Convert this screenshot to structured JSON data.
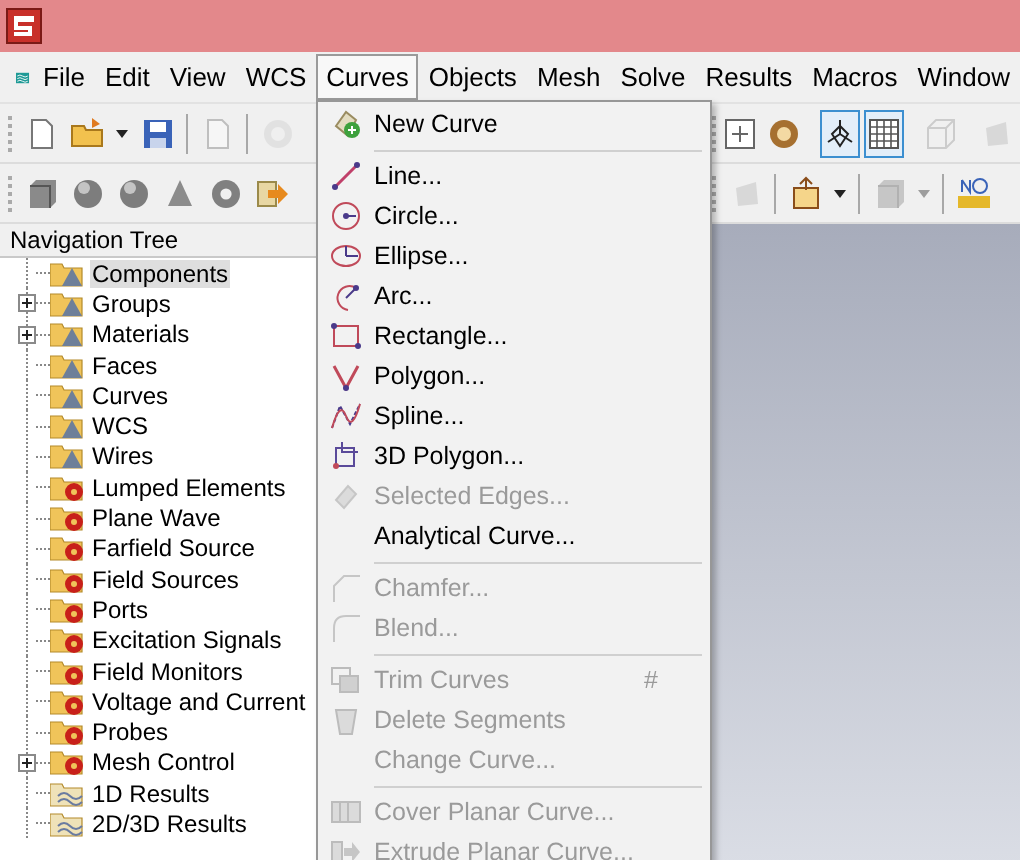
{
  "menu_bar": [
    {
      "label": "File",
      "selected": false
    },
    {
      "label": "Edit",
      "selected": false
    },
    {
      "label": "View",
      "selected": false
    },
    {
      "label": "WCS",
      "selected": false
    },
    {
      "label": "Curves",
      "selected": true
    },
    {
      "label": "Objects",
      "selected": false
    },
    {
      "label": "Mesh",
      "selected": false
    },
    {
      "label": "Solve",
      "selected": false
    },
    {
      "label": "Results",
      "selected": false
    },
    {
      "label": "Macros",
      "selected": false
    },
    {
      "label": "Window",
      "selected": false
    }
  ],
  "toolbar_1": {
    "left": [
      {
        "buttons": [
          {
            "kind": "page",
            "disabled": false,
            "pressed": false
          },
          {
            "kind": "folder",
            "disabled": false,
            "pressed": false
          },
          {
            "kind": "caret",
            "disabled": false,
            "pressed": false
          },
          {
            "kind": "save",
            "disabled": false,
            "pressed": false
          }
        ]
      },
      {
        "buttons": [
          {
            "kind": "page",
            "disabled": true,
            "pressed": false
          }
        ]
      },
      {
        "buttons": [
          {
            "kind": "circle",
            "disabled": true,
            "pressed": false
          }
        ]
      }
    ],
    "right": [
      {
        "buttons": [
          {
            "kind": "fit",
            "disabled": false,
            "pressed": false
          },
          {
            "kind": "gear",
            "disabled": false,
            "pressed": false
          }
        ]
      },
      {
        "buttons": [
          {
            "kind": "axes",
            "disabled": false,
            "pressed": true
          },
          {
            "kind": "grid",
            "disabled": false,
            "pressed": true
          }
        ]
      },
      {
        "buttons": [
          {
            "kind": "cube",
            "disabled": true,
            "pressed": false
          }
        ]
      },
      {
        "buttons": [
          {
            "kind": "shape",
            "disabled": true,
            "pressed": false
          }
        ]
      }
    ]
  },
  "toolbar_2": {
    "left": [
      {
        "buttons": [
          {
            "kind": "brick",
            "disabled": false,
            "pressed": false
          },
          {
            "kind": "sphere",
            "disabled": false,
            "pressed": false
          },
          {
            "kind": "sphere",
            "disabled": false,
            "pressed": false
          },
          {
            "kind": "cone",
            "disabled": false,
            "pressed": false
          },
          {
            "kind": "torus",
            "disabled": false,
            "pressed": false
          },
          {
            "kind": "import",
            "disabled": false,
            "pressed": false
          }
        ]
      }
    ],
    "right": [
      {
        "buttons": [
          {
            "kind": "shape",
            "disabled": true,
            "pressed": false
          }
        ]
      },
      {
        "buttons": [
          {
            "kind": "box",
            "disabled": false,
            "pressed": false
          },
          {
            "kind": "caret",
            "disabled": false,
            "pressed": false
          }
        ]
      },
      {
        "buttons": [
          {
            "kind": "brick",
            "disabled": true,
            "pressed": false
          },
          {
            "kind": "caret",
            "disabled": true,
            "pressed": false
          }
        ]
      },
      {
        "buttons": [
          {
            "kind": "ruler",
            "disabled": false,
            "pressed": false
          }
        ]
      }
    ]
  },
  "navigation_tree": {
    "title": "Navigation Tree",
    "items": [
      {
        "label": "Components",
        "kind": "model",
        "expandable": false,
        "selected": true
      },
      {
        "label": "Groups",
        "kind": "model",
        "expandable": true,
        "selected": false
      },
      {
        "label": "Materials",
        "kind": "model",
        "expandable": true,
        "selected": false
      },
      {
        "label": "Faces",
        "kind": "model",
        "expandable": false,
        "selected": false
      },
      {
        "label": "Curves",
        "kind": "model",
        "expandable": false,
        "selected": false
      },
      {
        "label": "WCS",
        "kind": "model",
        "expandable": false,
        "selected": false
      },
      {
        "label": "Wires",
        "kind": "model",
        "expandable": false,
        "selected": false
      },
      {
        "label": "Lumped Elements",
        "kind": "gear",
        "expandable": false,
        "selected": false
      },
      {
        "label": "Plane Wave",
        "kind": "gear",
        "expandable": false,
        "selected": false
      },
      {
        "label": "Farfield Source",
        "kind": "gear",
        "expandable": false,
        "selected": false
      },
      {
        "label": "Field Sources",
        "kind": "gear",
        "expandable": false,
        "selected": false
      },
      {
        "label": "Ports",
        "kind": "gear",
        "expandable": false,
        "selected": false
      },
      {
        "label": "Excitation Signals",
        "kind": "gear",
        "expandable": false,
        "selected": false
      },
      {
        "label": "Field Monitors",
        "kind": "gear",
        "expandable": false,
        "selected": false
      },
      {
        "label": "Voltage and Current",
        "kind": "gear",
        "expandable": false,
        "selected": false
      },
      {
        "label": "Probes",
        "kind": "gear",
        "expandable": false,
        "selected": false
      },
      {
        "label": "Mesh Control",
        "kind": "gear",
        "expandable": true,
        "selected": false
      },
      {
        "label": "1D Results",
        "kind": "results",
        "expandable": false,
        "selected": false
      },
      {
        "label": "2D/3D Results",
        "kind": "results",
        "expandable": false,
        "selected": false
      }
    ]
  },
  "curves_menu": [
    {
      "kind": "new-curve",
      "label": "New Curve",
      "disabled": false
    },
    {
      "kind": "separator"
    },
    {
      "kind": "line",
      "label": "Line...",
      "disabled": false
    },
    {
      "kind": "circle",
      "label": "Circle...",
      "disabled": false
    },
    {
      "kind": "ellipse",
      "label": "Ellipse...",
      "disabled": false
    },
    {
      "kind": "arc",
      "label": "Arc...",
      "disabled": false
    },
    {
      "kind": "rectangle",
      "label": "Rectangle...",
      "disabled": false
    },
    {
      "kind": "polygon",
      "label": "Polygon...",
      "disabled": false
    },
    {
      "kind": "spline",
      "label": "Spline...",
      "disabled": false
    },
    {
      "kind": "polygon3d",
      "label": "3D Polygon...",
      "disabled": false
    },
    {
      "kind": "edges",
      "label": "Selected Edges...",
      "disabled": true
    },
    {
      "kind": "plain",
      "label": "Analytical Curve...",
      "disabled": false
    },
    {
      "kind": "separator"
    },
    {
      "kind": "chamfer",
      "label": "Chamfer...",
      "disabled": true
    },
    {
      "kind": "blend",
      "label": "Blend...",
      "disabled": true
    },
    {
      "kind": "separator"
    },
    {
      "kind": "trim",
      "label": "Trim Curves",
      "disabled": true,
      "shortcut": "#"
    },
    {
      "kind": "delete",
      "label": "Delete Segments",
      "disabled": true
    },
    {
      "kind": "plain",
      "label": "Change Curve...",
      "disabled": true
    },
    {
      "kind": "separator"
    },
    {
      "kind": "cover",
      "label": "Cover Planar Curve...",
      "disabled": true
    },
    {
      "kind": "extrude",
      "label": "Extrude Planar Curve...",
      "disabled": true
    }
  ]
}
